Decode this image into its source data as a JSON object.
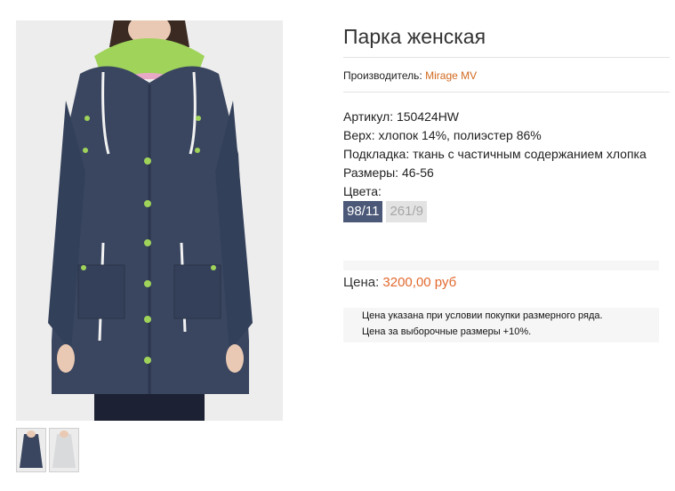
{
  "product": {
    "title": "Парка женская",
    "maker_label": "Производитель:",
    "maker_name": "Mirage MV",
    "article": "Артикул: 150424HW",
    "top": "Верх: хлопок 14%, полиэстер 86%",
    "lining": "Подкладка: ткань с частичным содержанием хлопка",
    "sizes": "Размеры: 46-56",
    "colors_label": "Цвета:",
    "colors": [
      "98/11",
      "261/9"
    ],
    "price_label": "Цена:",
    "price_value": "3200,00 руб",
    "note_line1": "Цена указана при условии покупки размерного ряда.",
    "note_line2": "Цена за выборочные размеры +10%."
  },
  "palette": {
    "accent": "#d2691e",
    "price": "#e2692f",
    "chip_active": "#4b5877",
    "chip_inactive": "#e3e3e3",
    "coat_navy": "#3a4660",
    "coat_lining_green": "#9fd35a"
  }
}
